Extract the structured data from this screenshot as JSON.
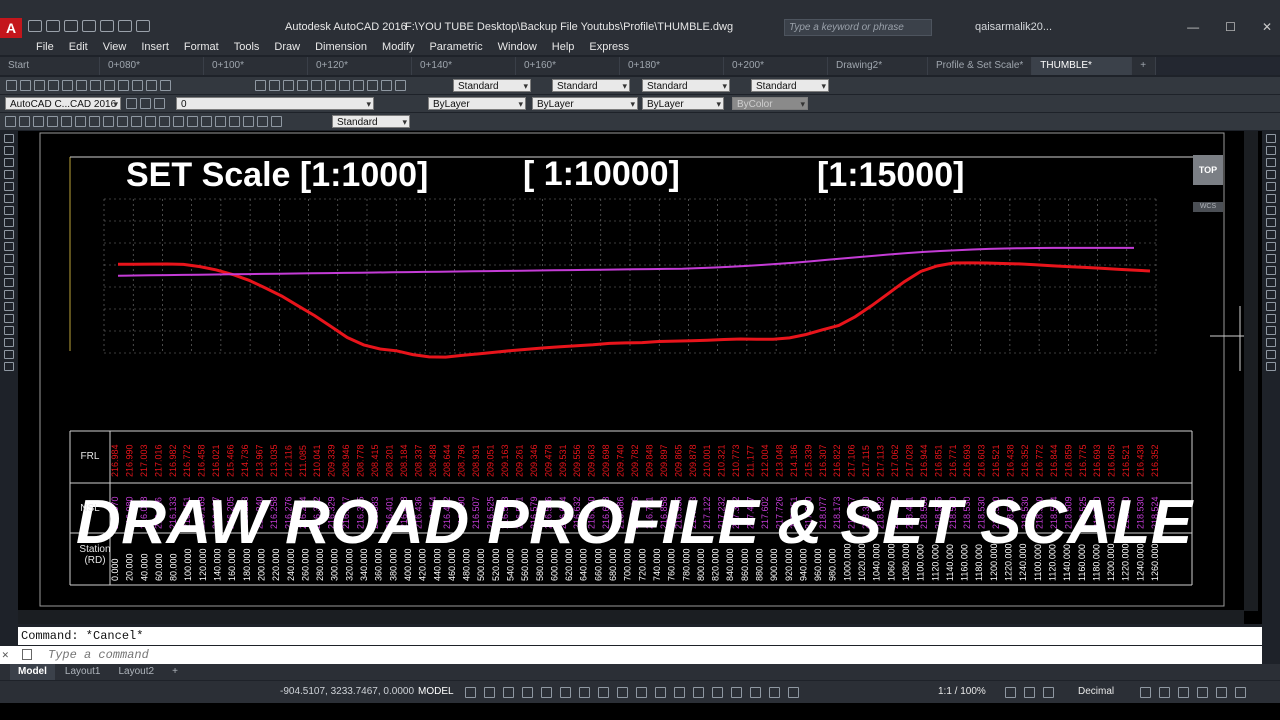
{
  "window": {
    "app_title": "Autodesk AutoCAD 2016",
    "file_path": "F:\\YOU TUBE Desktop\\Backup File Youtubs\\Profile\\THUMBLE.dwg",
    "search_placeholder": "Type a keyword or phrase",
    "user": "qaisarmalik20...",
    "logo_letter": "A",
    "minimize": "—",
    "maximize": "☐",
    "close": "✕"
  },
  "menu": [
    "File",
    "Edit",
    "View",
    "Insert",
    "Format",
    "Tools",
    "Draw",
    "Dimension",
    "Modify",
    "Parametric",
    "Window",
    "Help",
    "Express"
  ],
  "tabs": [
    {
      "label": "Start",
      "active": false
    },
    {
      "label": "0+080*",
      "active": false
    },
    {
      "label": "0+100*",
      "active": false
    },
    {
      "label": "0+120*",
      "active": false
    },
    {
      "label": "0+140*",
      "active": false
    },
    {
      "label": "0+160*",
      "active": false
    },
    {
      "label": "0+180*",
      "active": false
    },
    {
      "label": "0+200*",
      "active": false
    },
    {
      "label": "Drawing2*",
      "active": false
    },
    {
      "label": "Profile & Set Scale*",
      "active": false
    },
    {
      "label": "THUMBLE*",
      "active": true
    },
    {
      "label": "+",
      "active": false
    }
  ],
  "toolbars": {
    "text_style": "Standard",
    "dim_style": "Standard",
    "table_style": "Standard",
    "mleader_style": "Standard",
    "workspace": "AutoCAD C...CAD 2016",
    "layer": "0",
    "color": "ByLayer",
    "linetype": "ByLayer",
    "lineweight": "ByLayer",
    "plot_style": "ByColor",
    "dim_style_2": "Standard"
  },
  "drawing": {
    "scale_1": "SET Scale [1:1000]",
    "scale_2": "[ 1:10000]",
    "scale_3": "[1:15000]",
    "headline": "DRAW ROAD PROFILE & SET SCALE",
    "row_frl": "FRL",
    "row_nsl": "NSL",
    "row_station": "Station\n(RD)",
    "viewcube": "TOP",
    "wcs": "WCS",
    "colors": {
      "frl_line": "#e8141b",
      "nsl_line": "#c43cd6",
      "frl_text": "#e8141b",
      "nsl_text": "#c43cd6",
      "station_text": "#ffffff",
      "grid": "#7a7a7a"
    }
  },
  "table": {
    "frl": [
      "216.984",
      "216.990",
      "217.003",
      "217.016",
      "216.982",
      "216.772",
      "216.458",
      "216.021",
      "215.466",
      "214.736",
      "213.967",
      "213.035",
      "212.116",
      "211.085",
      "210.041",
      "209.339",
      "208.946",
      "208.778",
      "208.415",
      "208.201",
      "208.184",
      "208.337",
      "208.488",
      "208.644",
      "208.796",
      "208.931",
      "209.051",
      "209.163",
      "209.261",
      "209.346",
      "209.478",
      "209.531",
      "209.556",
      "209.663",
      "209.698",
      "209.740",
      "209.782",
      "209.848",
      "209.897",
      "209.865",
      "209.878",
      "210.001",
      "210.321",
      "210.773",
      "211.177",
      "212.004",
      "213.048",
      "214.186",
      "215.339",
      "216.307",
      "216.822",
      "217.106",
      "217.115",
      "217.113",
      "217.062",
      "217.028",
      "216.944",
      "216.851",
      "216.771",
      "216.693",
      "216.603",
      "216.521",
      "216.438",
      "216.352",
      "216.772",
      "216.844",
      "216.859",
      "216.775",
      "216.693",
      "216.605",
      "216.521",
      "216.438",
      "216.352"
    ],
    "nsl": [
      "216.070",
      "216.080",
      "216.098",
      "216.116",
      "216.133",
      "216.151",
      "216.169",
      "216.187",
      "216.205",
      "216.223",
      "216.240",
      "216.258",
      "216.276",
      "216.294",
      "216.312",
      "216.329",
      "216.347",
      "216.365",
      "216.383",
      "216.401",
      "216.418",
      "216.436",
      "216.454",
      "216.472",
      "216.490",
      "216.507",
      "216.525",
      "216.543",
      "216.561",
      "216.579",
      "216.596",
      "216.614",
      "216.632",
      "216.650",
      "216.668",
      "216.686",
      "216.736",
      "216.791",
      "216.858",
      "216.935",
      "217.023",
      "217.122",
      "217.232",
      "217.352",
      "217.477",
      "217.602",
      "217.726",
      "217.851",
      "217.970",
      "218.077",
      "218.173",
      "218.257",
      "218.330",
      "218.392",
      "218.442",
      "218.481",
      "218.509",
      "218.525",
      "218.530",
      "218.530",
      "218.530",
      "218.530",
      "218.530",
      "218.530",
      "218.530",
      "218.524",
      "218.509",
      "218.525",
      "218.530",
      "218.530",
      "218.530",
      "218.530",
      "218.524"
    ],
    "station": [
      "0.000",
      "20.000",
      "40.000",
      "60.000",
      "80.000",
      "100.000",
      "120.000",
      "140.000",
      "160.000",
      "180.000",
      "200.000",
      "220.000",
      "240.000",
      "260.000",
      "280.000",
      "300.000",
      "320.000",
      "340.000",
      "360.000",
      "380.000",
      "400.000",
      "420.000",
      "440.000",
      "460.000",
      "480.000",
      "500.000",
      "520.000",
      "540.000",
      "560.000",
      "580.000",
      "600.000",
      "620.000",
      "640.000",
      "660.000",
      "680.000",
      "700.000",
      "720.000",
      "740.000",
      "760.000",
      "780.000",
      "800.000",
      "820.000",
      "840.000",
      "860.000",
      "880.000",
      "900.000",
      "920.000",
      "940.000",
      "960.000",
      "980.000",
      "1000.000",
      "1020.000",
      "1040.000",
      "1060.000",
      "1080.000",
      "1100.000",
      "1120.000",
      "1140.000",
      "1160.000",
      "1180.000",
      "1200.000",
      "1220.000",
      "1240.000",
      "1100.000",
      "1120.000",
      "1140.000",
      "1160.000",
      "1180.000",
      "1200.000",
      "1220.000",
      "1240.000",
      "1260.000"
    ]
  },
  "command": {
    "history": "Command: *Cancel*",
    "placeholder": "Type a command",
    "close": "✕",
    "arrow": "⌃"
  },
  "layout_tabs": [
    {
      "label": "Model",
      "active": true
    },
    {
      "label": "Layout1",
      "active": false
    },
    {
      "label": "Layout2",
      "active": false
    },
    {
      "label": "+",
      "active": false
    }
  ],
  "status": {
    "coords": "-904.5107, 3233.7467, 0.0000",
    "model": "MODEL",
    "anno_scale": "1:1 / 100%",
    "units": "Decimal"
  }
}
